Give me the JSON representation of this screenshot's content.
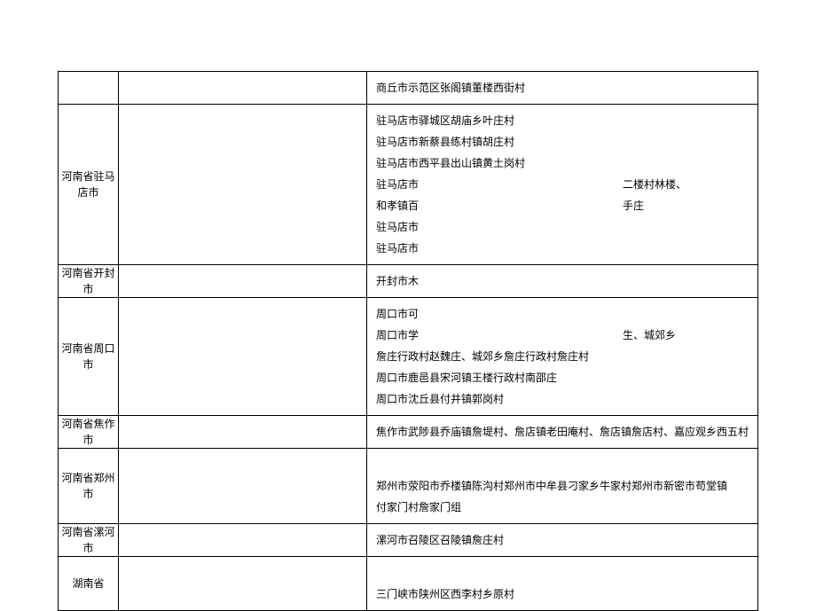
{
  "rows": [
    {
      "left": "",
      "right": [
        "商丘市示范区张阁镇董楼西街村"
      ]
    },
    {
      "left": "河南省驻马店市",
      "right": [
        "驻马店市驿城区胡庙乡叶庄村",
        "驻马店市新蔡县练村镇胡庄村",
        "驻马店市西平县出山镇黄土岗村",
        {
          "l": "驻马店市",
          "r": "二楼村林楼、"
        },
        {
          "l": "和孝镇百",
          "r": "手庄"
        },
        "驻马店市",
        "驻马店市"
      ]
    },
    {
      "left": "河南省开封市",
      "right": [
        "开封市木"
      ]
    },
    {
      "left": "河南省周口市",
      "right": [
        "周口市可",
        {
          "l": "周口市学",
          "r": "生、城郊乡"
        },
        "詹庄行政村赵魏庄、城郊乡詹庄行政村詹庄村",
        "周口市鹿邑县宋河镇王楼行政村南邵庄",
        "周口市沈丘县付井镇郭岗村"
      ]
    },
    {
      "left": "河南省焦作市",
      "right": [
        "焦作市武陟县乔庙镇詹堤村、詹店镇老田庵村、詹店镇詹店村、嘉应观乡西五村"
      ]
    },
    {
      "left": "河南省郑州市",
      "right": [
        "",
        "郑州市荥阳市乔楼镇陈沟村郑州市中牟县刁家乡牛家村郑州市新密市苟堂镇",
        "付家门村詹家门组"
      ]
    },
    {
      "left": "河南省漯河市",
      "right": [
        "漯河市召陵区召陵镇詹庄村"
      ]
    },
    {
      "left": "湖南省",
      "right": [
        "",
        "三门峡市陕州区西李村乡原村"
      ]
    }
  ]
}
